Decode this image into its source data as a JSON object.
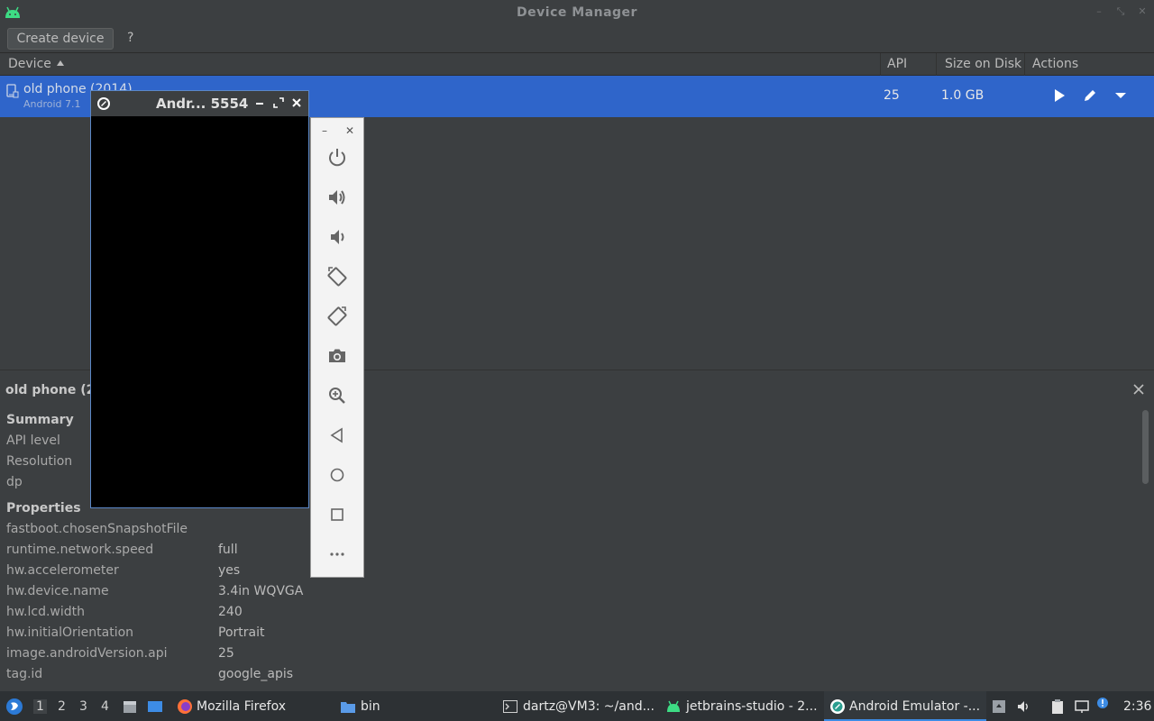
{
  "window": {
    "title": "Device Manager"
  },
  "toolbar": {
    "create_label": "Create device",
    "help_label": "?"
  },
  "table": {
    "columns": {
      "device": "Device",
      "api": "API",
      "size": "Size on Disk",
      "actions": "Actions"
    },
    "row": {
      "name": "old phone (2014)",
      "subtitle": "Android 7.1",
      "api": "25",
      "size": "1.0 GB"
    }
  },
  "emulator": {
    "title": "Andr... 5554"
  },
  "details": {
    "title": "old phone (2",
    "summary_heading": "Summary",
    "summary": [
      {
        "label": "API level"
      },
      {
        "label": "Resolution"
      },
      {
        "label": "dp"
      }
    ],
    "properties_heading": "Properties",
    "properties": [
      {
        "label": "fastboot.chosenSnapshotFile",
        "value": ""
      },
      {
        "label": "runtime.network.speed",
        "value": "full"
      },
      {
        "label": "hw.accelerometer",
        "value": "yes"
      },
      {
        "label": "hw.device.name",
        "value": "3.4in WQVGA"
      },
      {
        "label": "hw.lcd.width",
        "value": "240"
      },
      {
        "label": "hw.initialOrientation",
        "value": "Portrait"
      },
      {
        "label": "image.androidVersion.api",
        "value": "25"
      },
      {
        "label": "tag.id",
        "value": "google_apis"
      }
    ]
  },
  "taskbar": {
    "workspaces": [
      "1",
      "2",
      "3",
      "4"
    ],
    "tasks": [
      {
        "label": "Mozilla Firefox"
      },
      {
        "label": "bin"
      },
      {
        "label": "dartz@VM3: ~/and..."
      },
      {
        "label": "jetbrains-studio - 2..."
      },
      {
        "label": "Android Emulator -..."
      }
    ],
    "clock": "2:36"
  },
  "colors": {
    "selection": "#2f65ca",
    "accent": "#3d8ce5",
    "background": "#3c3f41"
  }
}
